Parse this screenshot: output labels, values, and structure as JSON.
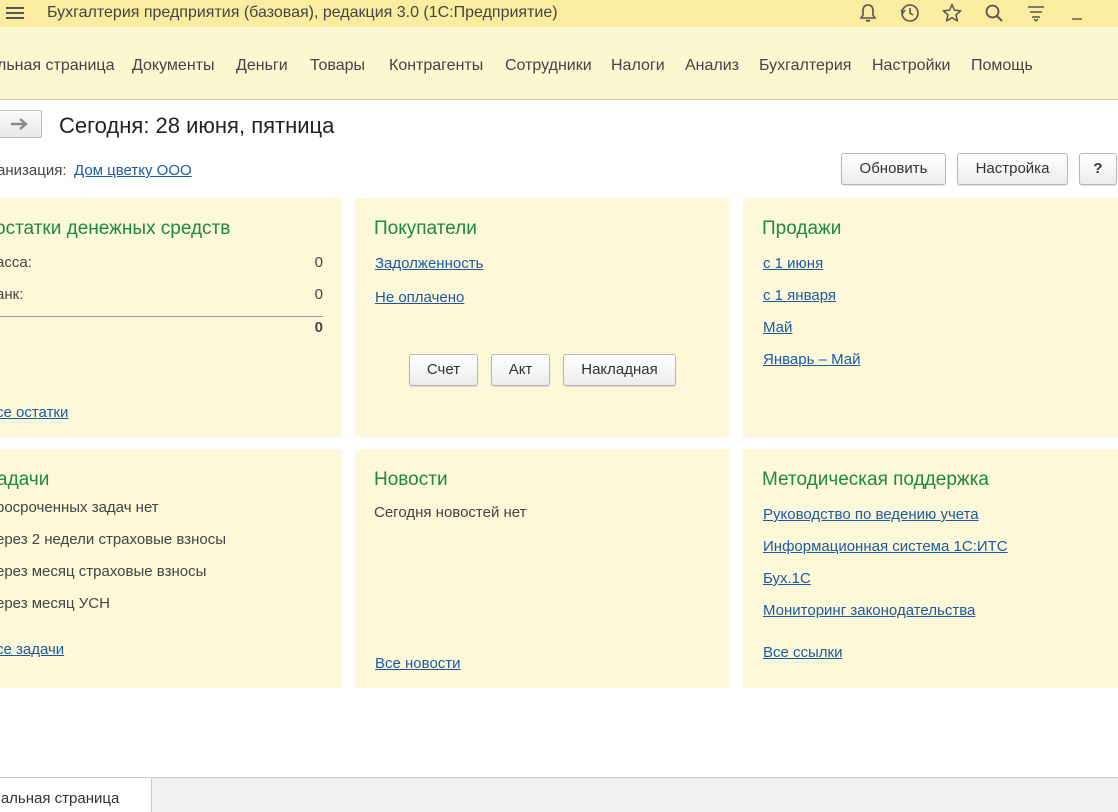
{
  "window": {
    "title": "Бухгалтерия предприятия (базовая), редакция 3.0  (1С:Предприятие)"
  },
  "toolbar_icons": [
    "bell-icon",
    "history-icon",
    "star-icon",
    "search-icon",
    "menu-lines-icon",
    "minimize-icon"
  ],
  "nav": {
    "items": [
      "льная страница",
      "Документы",
      "Деньги",
      "Товары",
      "Контрагенты",
      "Сотрудники",
      "Налоги",
      "Анализ",
      "Бухгалтерия",
      "Настройки",
      "Помощь"
    ]
  },
  "page": {
    "title": "Сегодня: 28 июня, пятница",
    "org_label": "анизация:",
    "org_value": "Дом цветку ООО",
    "refresh_label": "Обновить",
    "settings_label": "Настройка",
    "help_label": "?"
  },
  "cash": {
    "title": "остатки денежных средств",
    "kassa_label": "асса:",
    "kassa_value": "0",
    "bank_label": "анк:",
    "bank_value": "0",
    "total_value": "0",
    "all_link": "се остатки"
  },
  "buyers": {
    "title": "Покупатели",
    "debt_link": "Задолженность",
    "unpaid_link": "Не оплачено",
    "invoice_label": "Счет",
    "act_label": "Акт",
    "waybill_label": "Накладная"
  },
  "sales": {
    "title": "Продажи",
    "links": [
      "с 1 июня",
      "с 1 января",
      "Май",
      "Январь – Май"
    ]
  },
  "tasks": {
    "title": "адачи",
    "items": [
      "росроченных задач нет",
      "ерез 2 недели страховые взносы",
      "ерез месяц страховые взносы",
      "ерез месяц УСН"
    ],
    "all_link": "се задачи"
  },
  "news": {
    "title": "Новости",
    "empty_text": "Сегодня новостей нет",
    "all_link": "Все новости"
  },
  "support": {
    "title": "Методическая поддержка",
    "links": [
      "Руководство по ведению учета",
      "Информационная система 1С:ИТС",
      "Бух.1С",
      "Мониторинг законодательства"
    ],
    "all_link": "Все ссылки"
  },
  "footer": {
    "tab_label": "чальная страница"
  },
  "colors": {
    "titlebar": "#fbeda0",
    "navbar": "#fcf6d1",
    "panel": "#fdf8d8",
    "panel_title": "#1c8a3f",
    "link": "#1c5aa4"
  }
}
